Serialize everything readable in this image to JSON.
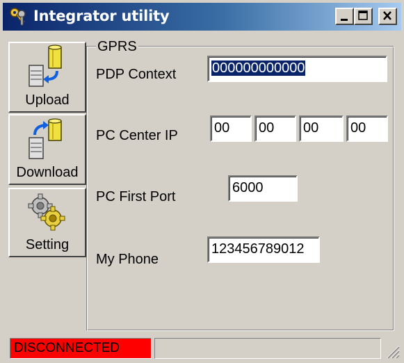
{
  "window": {
    "title": "Integrator utility"
  },
  "toolbar": {
    "upload_label": "Upload",
    "download_label": "Download",
    "setting_label": "Setting"
  },
  "group": {
    "title": "GPRS"
  },
  "fields": {
    "pdp_context_label": "PDP Context",
    "pdp_context_value": "000000000000",
    "pc_center_ip_label": "PC  Center IP",
    "ip": [
      "00",
      "00",
      "00",
      "00"
    ],
    "pc_first_port_label": "PC First Port",
    "pc_first_port_value": "6000",
    "my_phone_label": "My Phone",
    "my_phone_value": "123456789012"
  },
  "status": {
    "connection": "DISCONNECTED",
    "connection_color": "#ff0000"
  },
  "colors": {
    "titlebar_start": "#0a246a",
    "titlebar_end": "#a6caf0",
    "face": "#d4d0c8"
  },
  "icons": {
    "title": "keys-icon",
    "upload": "database-upload-icon",
    "download": "database-download-icon",
    "setting": "gears-icon"
  }
}
